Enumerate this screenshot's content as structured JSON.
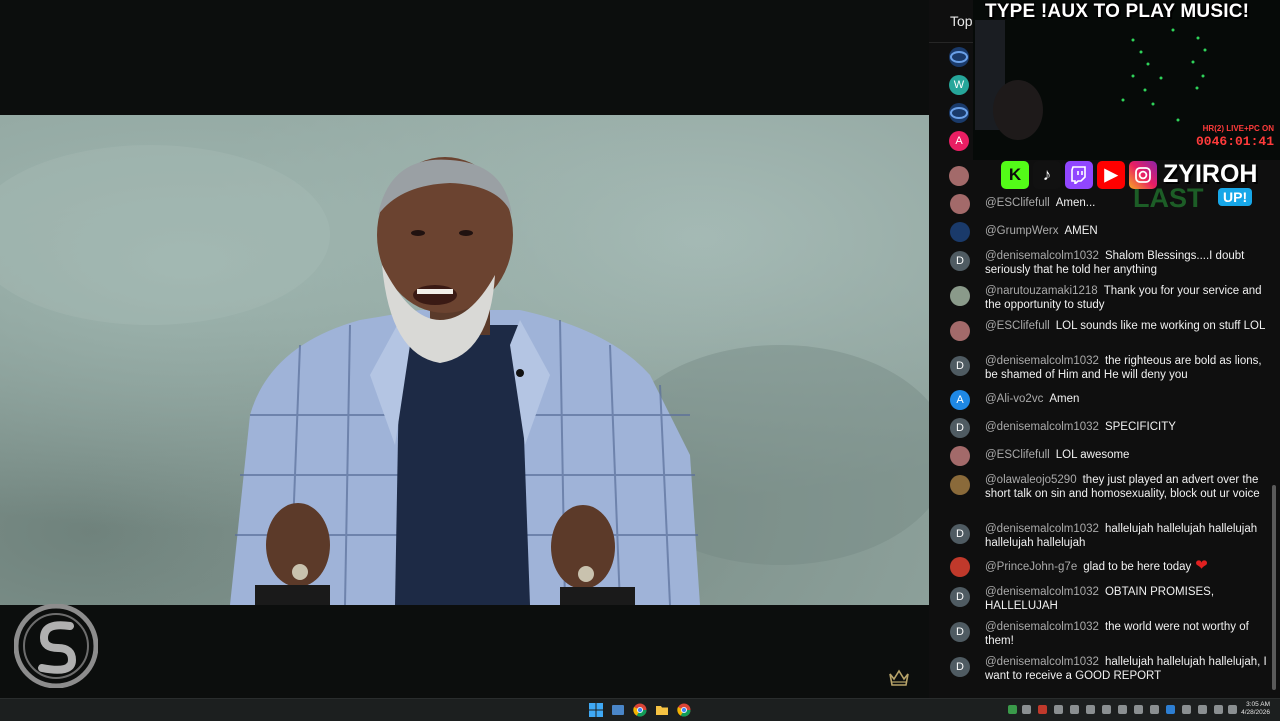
{
  "chat": {
    "tab_label": "Top",
    "messages": [
      {
        "author": "@ESClifefull",
        "text": "Amen...",
        "avatar": "photo"
      },
      {
        "author": "@GrumpWerx",
        "text": "AMEN",
        "avatar": "logo"
      },
      {
        "author": "@denisemalcolm1032",
        "text": "Shalom Blessings....I doubt seriously that he told her anything",
        "avatar": "D"
      },
      {
        "author": "@narutouzamaki1218",
        "text": "Thank you for your service and the opportunity to study",
        "avatar": "photo"
      },
      {
        "author": "@ESClifefull",
        "text": "LOL sounds like me working on stuff LOL",
        "avatar": "photo"
      },
      {
        "author": "@denisemalcolm1032",
        "text": "the righteous are bold as lions, be shamed of Him and He will deny you",
        "avatar": "D"
      },
      {
        "author": "@Ali-vo2vc",
        "text": "Amen",
        "avatar": "A"
      },
      {
        "author": "@denisemalcolm1032",
        "text": "SPECIFICITY",
        "avatar": "D"
      },
      {
        "author": "@ESClifefull",
        "text": "LOL awesome",
        "avatar": "photo"
      },
      {
        "author": "@olawaleojo5290",
        "text": "they just played an advert over the short talk on sin and homosexuality, block out ur voice",
        "avatar": "photo"
      },
      {
        "author": "@denisemalcolm1032",
        "text": "hallelujah hallelujah hallelujah hallelujah hallelujah",
        "avatar": "D"
      },
      {
        "author": "@PrinceJohn-g7e",
        "text": "glad to be here today",
        "avatar": "photo"
      },
      {
        "author": "@denisemalcolm1032",
        "text": "OBTAIN PROMISES, HALLELUJAH",
        "avatar": "D"
      },
      {
        "author": "@denisemalcolm1032",
        "text": "the world were not worthy of them!",
        "avatar": "D"
      },
      {
        "author": "@denisemalcolm1032",
        "text": "hallelujah hallelujah hallelujah, I want to receive a GOOD REPORT",
        "avatar": "D"
      }
    ],
    "partial_avatars": [
      "W",
      "A"
    ]
  },
  "overlay": {
    "title": "TYPE !AUX TO PLAY MUSIC!",
    "live_text": "HR(2) LIVE+PC ON",
    "timer": "0046:01:41",
    "handle": "ZYIROH",
    "last_text": "LAST",
    "up_badge": "UP!",
    "social_icons": [
      "kick-icon",
      "tiktok-icon",
      "twitch-icon",
      "youtube-icon",
      "instagram-icon"
    ]
  },
  "taskbar": {
    "time": "3:05 AM",
    "date": "4/28/2026"
  },
  "colors": {
    "chat_bg": "#0f0f0f",
    "author": "#aaaaaa",
    "avatar_d": "#4f5b62",
    "avatar_a": "#1e88e5",
    "kick": "#53fc18",
    "twitch": "#9146ff",
    "youtube": "#ff0000"
  }
}
